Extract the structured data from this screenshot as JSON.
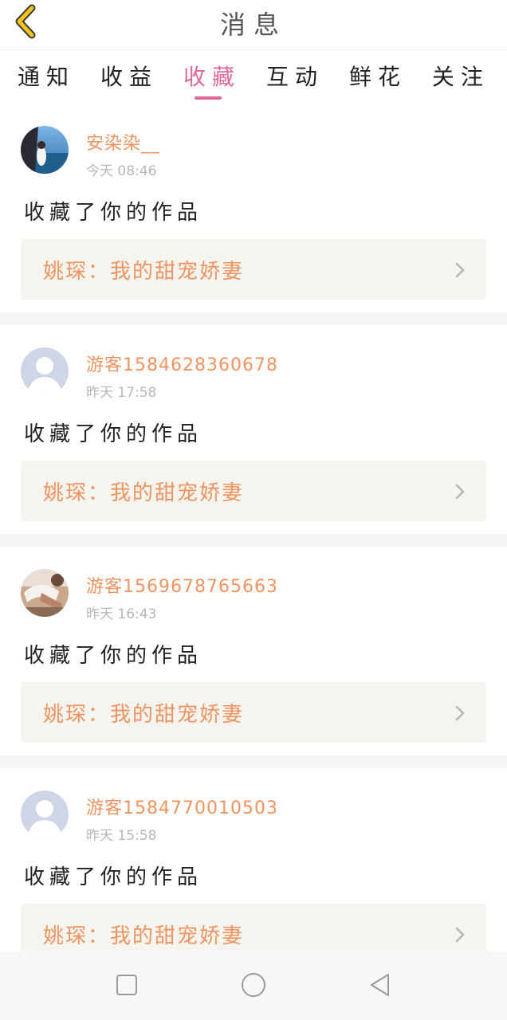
{
  "header": {
    "title": "消息",
    "back_icon": "chevron-left-icon"
  },
  "tabs": [
    {
      "label": "通知",
      "active": false
    },
    {
      "label": "收益",
      "active": false
    },
    {
      "label": "收藏",
      "active": true
    },
    {
      "label": "互动",
      "active": false
    },
    {
      "label": "鲜花",
      "active": false
    },
    {
      "label": "关注",
      "active": false
    }
  ],
  "items": [
    {
      "username": "安染染__",
      "time": "今天 08:46",
      "action": "收藏了你的作品",
      "work": "姚琛：我的甜宠娇妻",
      "avatar": "photo-avatar-sea"
    },
    {
      "username": "游客1584628360678",
      "time": "昨天 17:58",
      "action": "收藏了你的作品",
      "work": "姚琛：我的甜宠娇妻",
      "avatar": "default-avatar"
    },
    {
      "username": "游客1569678765663",
      "time": "昨天 16:43",
      "action": "收藏了你的作品",
      "work": "姚琛：我的甜宠娇妻",
      "avatar": "photo-avatar"
    },
    {
      "username": "游客1584770010503",
      "time": "昨天 15:58",
      "action": "收藏了你的作品",
      "work": "姚琛：我的甜宠娇妻",
      "avatar": "default-avatar"
    }
  ],
  "colors": {
    "accent": "#e0689a",
    "username": "#ef9460",
    "back": "#f0c419"
  },
  "navbar": {
    "icons": [
      "square-icon",
      "circle-icon",
      "triangle-back-icon"
    ]
  }
}
